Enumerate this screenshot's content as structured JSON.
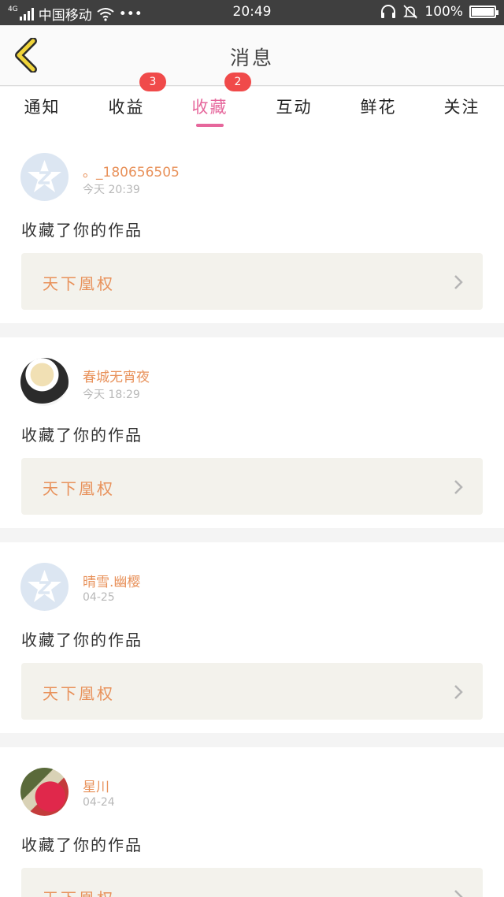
{
  "status_bar": {
    "network": "4G",
    "carrier": "中国移动",
    "more": "•••",
    "time": "20:49",
    "battery": "100%",
    "battery_level": 1.0
  },
  "header": {
    "title": "消息"
  },
  "tabs": [
    {
      "label": "通知",
      "badge": ""
    },
    {
      "label": "收益",
      "badge": "3"
    },
    {
      "label": "收藏",
      "badge": "2",
      "active": true
    },
    {
      "label": "互动",
      "badge": ""
    },
    {
      "label": "鲜花",
      "badge": ""
    },
    {
      "label": "关注",
      "badge": ""
    }
  ],
  "feed": [
    {
      "username": "。_180656505",
      "time": "今天 20:39",
      "action": "收藏了你的作品",
      "work_title": "天下凰权",
      "avatar": "default-avatar"
    },
    {
      "username": "春城无宵夜",
      "time": "今天 18:29",
      "action": "收藏了你的作品",
      "work_title": "天下凰权",
      "avatar": "photo-avatar"
    },
    {
      "username": "晴雪.幽樱",
      "time": "04-25",
      "action": "收藏了你的作品",
      "work_title": "天下凰权",
      "avatar": "default-avatar"
    },
    {
      "username": "星川",
      "time": "04-24",
      "action": "收藏了你的作品",
      "work_title": "天下凰权",
      "avatar": "photo-avatar"
    }
  ],
  "colors": {
    "accent": "#e6679c",
    "name": "#e8915a",
    "badge": "#f04a4a",
    "back_arrow": "#f0d43a"
  }
}
